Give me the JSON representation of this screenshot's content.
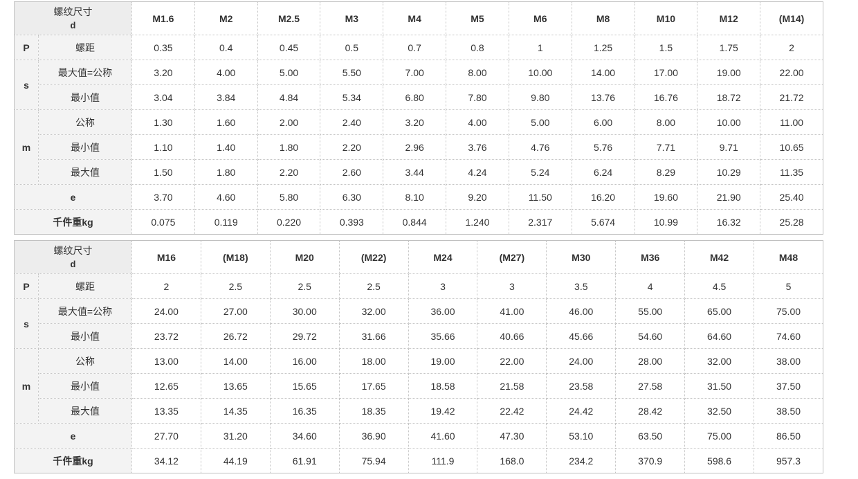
{
  "header": {
    "title": "螺纹尺寸",
    "sub": "d"
  },
  "labels": {
    "P": "P",
    "pitch": "螺距",
    "s": "s",
    "s_max": "最大值=公称",
    "s_min": "最小值",
    "m": "m",
    "m_nom": "公称",
    "m_min": "最小值",
    "m_max": "最大值",
    "e": "e",
    "weight": "千件重kg"
  },
  "tables": [
    {
      "sizes": [
        "M1.6",
        "M2",
        "M2.5",
        "M3",
        "M4",
        "M5",
        "M6",
        "M8",
        "M10",
        "M12",
        "(M14)"
      ],
      "P": [
        "0.35",
        "0.4",
        "0.45",
        "0.5",
        "0.7",
        "0.8",
        "1",
        "1.25",
        "1.5",
        "1.75",
        "2"
      ],
      "s_max": [
        "3.20",
        "4.00",
        "5.00",
        "5.50",
        "7.00",
        "8.00",
        "10.00",
        "14.00",
        "17.00",
        "19.00",
        "22.00"
      ],
      "s_min": [
        "3.04",
        "3.84",
        "4.84",
        "5.34",
        "6.80",
        "7.80",
        "9.80",
        "13.76",
        "16.76",
        "18.72",
        "21.72"
      ],
      "m_nom": [
        "1.30",
        "1.60",
        "2.00",
        "2.40",
        "3.20",
        "4.00",
        "5.00",
        "6.00",
        "8.00",
        "10.00",
        "11.00"
      ],
      "m_min": [
        "1.10",
        "1.40",
        "1.80",
        "2.20",
        "2.96",
        "3.76",
        "4.76",
        "5.76",
        "7.71",
        "9.71",
        "10.65"
      ],
      "m_max": [
        "1.50",
        "1.80",
        "2.20",
        "2.60",
        "3.44",
        "4.24",
        "5.24",
        "6.24",
        "8.29",
        "10.29",
        "11.35"
      ],
      "e": [
        "3.70",
        "4.60",
        "5.80",
        "6.30",
        "8.10",
        "9.20",
        "11.50",
        "16.20",
        "19.60",
        "21.90",
        "25.40"
      ],
      "weight": [
        "0.075",
        "0.119",
        "0.220",
        "0.393",
        "0.844",
        "1.240",
        "2.317",
        "5.674",
        "10.99",
        "16.32",
        "25.28"
      ]
    },
    {
      "sizes": [
        "M16",
        "(M18)",
        "M20",
        "(M22)",
        "M24",
        "(M27)",
        "M30",
        "M36",
        "M42",
        "M48"
      ],
      "P": [
        "2",
        "2.5",
        "2.5",
        "2.5",
        "3",
        "3",
        "3.5",
        "4",
        "4.5",
        "5"
      ],
      "s_max": [
        "24.00",
        "27.00",
        "30.00",
        "32.00",
        "36.00",
        "41.00",
        "46.00",
        "55.00",
        "65.00",
        "75.00"
      ],
      "s_min": [
        "23.72",
        "26.72",
        "29.72",
        "31.66",
        "35.66",
        "40.66",
        "45.66",
        "54.60",
        "64.60",
        "74.60"
      ],
      "m_nom": [
        "13.00",
        "14.00",
        "16.00",
        "18.00",
        "19.00",
        "22.00",
        "24.00",
        "28.00",
        "32.00",
        "38.00"
      ],
      "m_min": [
        "12.65",
        "13.65",
        "15.65",
        "17.65",
        "18.58",
        "21.58",
        "23.58",
        "27.58",
        "31.50",
        "37.50"
      ],
      "m_max": [
        "13.35",
        "14.35",
        "16.35",
        "18.35",
        "19.42",
        "22.42",
        "24.42",
        "28.42",
        "32.50",
        "38.50"
      ],
      "e": [
        "27.70",
        "31.20",
        "34.60",
        "36.90",
        "41.60",
        "47.30",
        "53.10",
        "63.50",
        "75.00",
        "86.50"
      ],
      "weight": [
        "34.12",
        "44.19",
        "61.91",
        "75.94",
        "111.9",
        "168.0",
        "234.2",
        "370.9",
        "598.6",
        "957.3"
      ]
    }
  ]
}
